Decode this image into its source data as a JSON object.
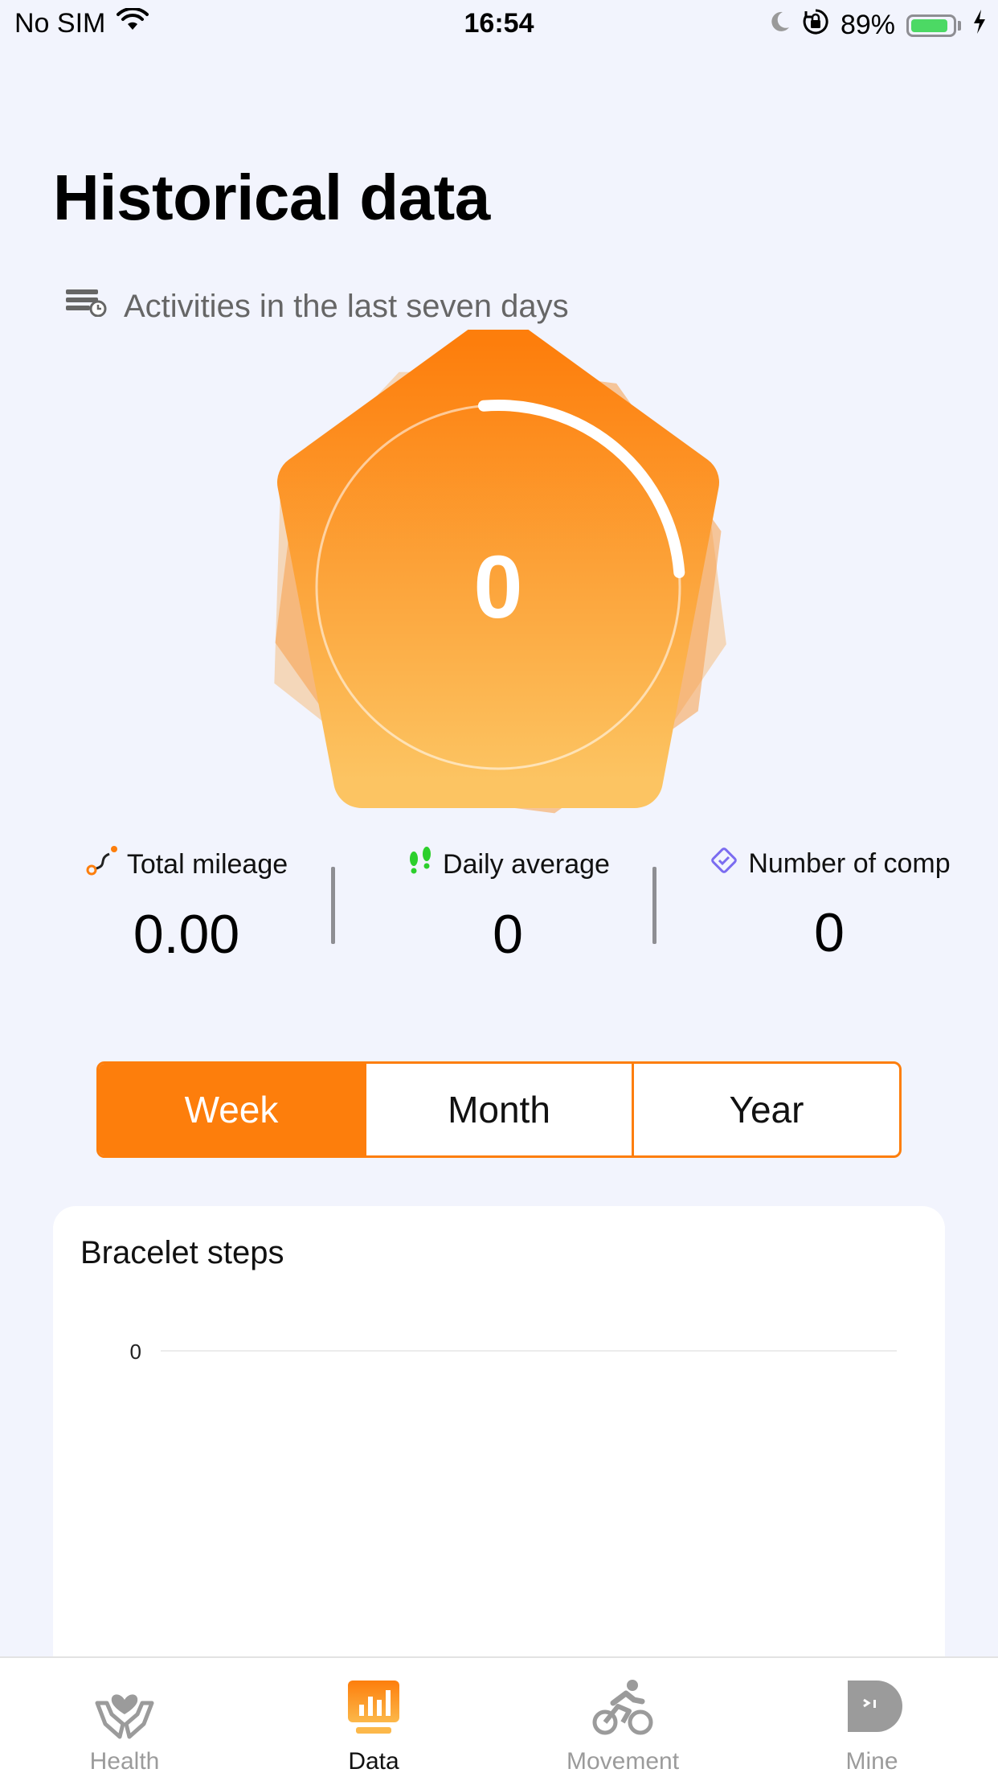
{
  "status_bar": {
    "carrier": "No SIM",
    "time": "16:54",
    "battery_percent": "89%",
    "battery_level": 0.89,
    "icons": [
      "wifi-icon",
      "moon-icon",
      "orientation-lock-icon",
      "battery-icon",
      "charging-bolt-icon"
    ]
  },
  "page": {
    "title": "Historical data",
    "subtitle": "Activities in the last seven days"
  },
  "hero": {
    "value": "0",
    "progress": 0.25,
    "accent_color": "#fd7e0c"
  },
  "stats": [
    {
      "label": "Total mileage",
      "value": "0.00",
      "icon": "route-icon"
    },
    {
      "label": "Daily average",
      "value": "0",
      "icon": "footprints-icon"
    },
    {
      "label": "Number of comp",
      "value": "0",
      "icon": "diamond-check-icon"
    }
  ],
  "periods": {
    "options": [
      "Week",
      "Month",
      "Year"
    ],
    "selected": "Week"
  },
  "steps_card": {
    "title": "Bracelet steps",
    "chart_data": {
      "type": "bar",
      "title": "Bracelet steps",
      "categories": [],
      "values": [],
      "y_ticks": [
        "0"
      ],
      "ylim": [
        0,
        0
      ],
      "grid": true
    }
  },
  "tabbar": {
    "items": [
      {
        "label": "Health",
        "icon": "hands-heart-icon",
        "active": false
      },
      {
        "label": "Data",
        "icon": "chart-monitor-icon",
        "active": true
      },
      {
        "label": "Movement",
        "icon": "cyclist-icon",
        "active": false
      },
      {
        "label": "Mine",
        "icon": "profile-bubble-icon",
        "active": false
      }
    ]
  },
  "colors": {
    "accent": "#fd7e0c",
    "background": "#f2f4fd",
    "inactive_tab": "#9b9b9b",
    "footprints": "#2ccf2c",
    "diamond": "#7b6cf0"
  }
}
